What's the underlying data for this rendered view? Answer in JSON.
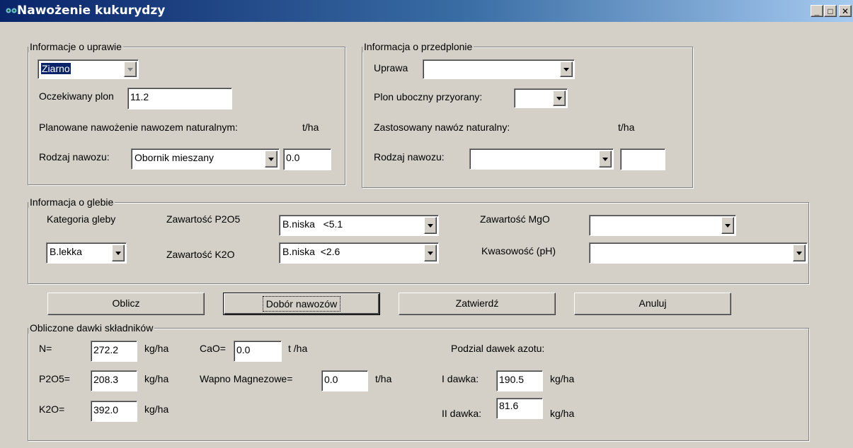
{
  "window": {
    "title": "Nawożenie kukurydzy",
    "minimize_glyph": "_",
    "maximize_glyph": "□",
    "close_glyph": "✕"
  },
  "uprawa": {
    "legend": "Informacje o uprawie",
    "crop_type": "Ziarno",
    "expected_yield_label": "Oczekiwany plon",
    "expected_yield": "11.2",
    "planned_label": "Planowane nawożenie nawozem naturalnym:",
    "unit_tha": "t/ha",
    "fert_type_label": "Rodzaj nawozu:",
    "fert_type": "Obornik mieszany",
    "fert_amount": "0.0"
  },
  "przedplon": {
    "legend": "Informacja o przedplonie",
    "crop_label": "Uprawa",
    "crop": "",
    "byproduct_label": "Plon uboczny przyorany:",
    "byproduct": "",
    "applied_label": "Zastosowany nawóz naturalny:",
    "unit_tha": "t/ha",
    "fert_type_label": "Rodzaj nawozu:",
    "fert_type": "",
    "fert_amount": ""
  },
  "gleba": {
    "legend": "Informacja o glebie",
    "category_label": "Kategoria gleby",
    "category": "B.lekka",
    "p2o5_label": "Zawartość P2O5",
    "p2o5": "B.niska   <5.1",
    "k2o_label": "Zawartość K2O",
    "k2o": "B.niska  <2.6",
    "mgo_label": "Zawartość MgO",
    "mgo": "",
    "ph_label": "Kwasowość (pH)",
    "ph": ""
  },
  "buttons": {
    "oblicz": "Oblicz",
    "dobor": "Dobór nawozów",
    "zatwierdz": "Zatwierdź",
    "anuluj": "Anuluj"
  },
  "dawki": {
    "legend": "Obliczone dawki składników",
    "n_label": "N=",
    "n_value": "272.2",
    "p2o5_label": "P2O5=",
    "p2o5_value": "208.3",
    "k2o_label": "K2O=",
    "k2o_value": "392.0",
    "unit_kgha": "kg/ha",
    "cao_label": "CaO=",
    "cao_value": "0.0",
    "cao_unit": "t /ha",
    "wapno_label": "Wapno Magnezowe=",
    "wapno_value": "0.0",
    "wapno_unit": "t/ha",
    "split_label": "Podzial dawek azotu:",
    "dose1_label": "I dawka:",
    "dose1_value": "190.5",
    "dose2_label": "II dawka:",
    "dose2_value": "81.6"
  }
}
